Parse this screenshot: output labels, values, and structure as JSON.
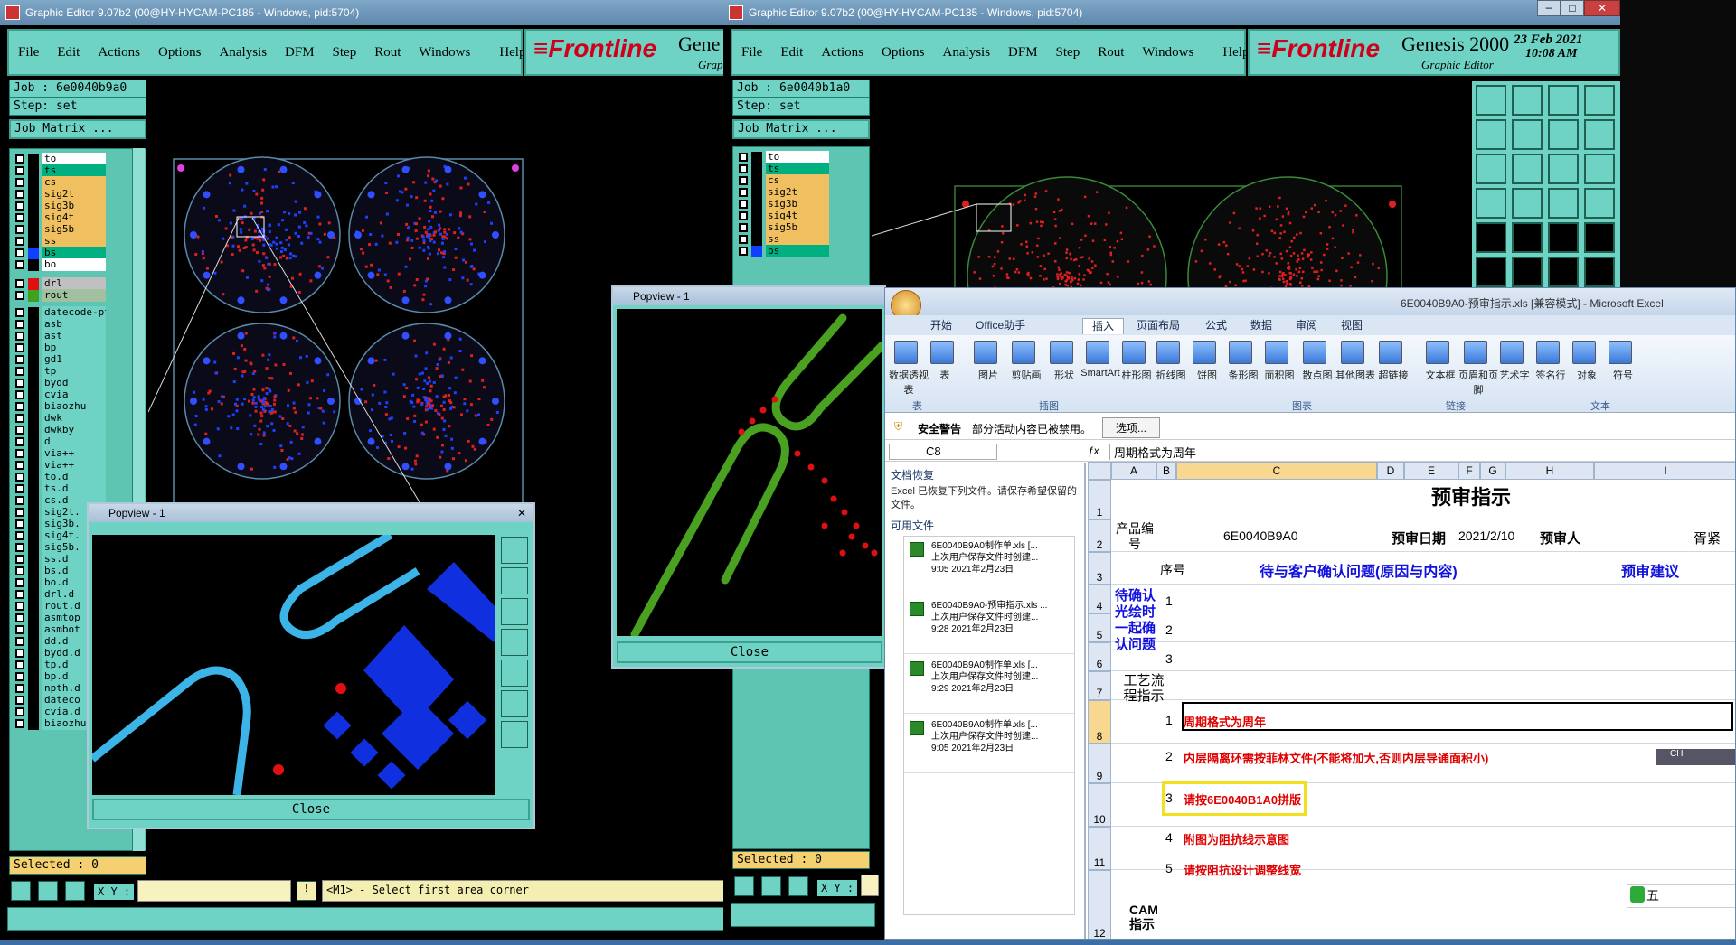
{
  "win1": {
    "title": "Graphic Editor 9.07b2 (00@HY-HYCAM-PC185 - Windows, pid:5704)",
    "menu": [
      "File",
      "Edit",
      "Actions",
      "Options",
      "Analysis",
      "DFM",
      "Step",
      "Rout",
      "Windows",
      "Help"
    ],
    "job": "Job : 6e0040b9a0",
    "step": "Step: set",
    "job_matrix": "Job Matrix ...",
    "selected": "Selected : 0",
    "xy_label": "X Y :",
    "prompt": "<M1> - Select first area corner",
    "brand_partial": "Gene",
    "brand_sub_partial": "Grap"
  },
  "win2": {
    "title": "Graphic Editor 9.07b2 (00@HY-HYCAM-PC185 - Windows, pid:5704)",
    "menu": [
      "File",
      "Edit",
      "Actions",
      "Options",
      "Analysis",
      "DFM",
      "Step",
      "Rout",
      "Windows",
      "Help"
    ],
    "job": "Job : 6e0040b1a0",
    "step": "Step: set",
    "job_matrix": "Job Matrix ...",
    "selected": "Selected : 0",
    "xy_label": "X Y :",
    "brand_title": "Genesis 2000",
    "brand_sub": "Graphic Editor",
    "date": "23 Feb 2021",
    "time": "10:08 AM"
  },
  "brand_logo": "Frontline",
  "layers_top": [
    {
      "name": "to",
      "color": "#ffffff"
    },
    {
      "name": "ts",
      "color": "#00b080"
    },
    {
      "name": "cs",
      "color": "#f0c060"
    },
    {
      "name": "sig2t",
      "color": "#f0c060"
    },
    {
      "name": "sig3b",
      "color": "#f0c060"
    },
    {
      "name": "sig4t",
      "color": "#f0c060"
    },
    {
      "name": "sig5b",
      "color": "#f0c060"
    },
    {
      "name": "ss",
      "color": "#f0c060"
    },
    {
      "name": "bs",
      "color": "#00b080"
    },
    {
      "name": "bo",
      "color": "#ffffff"
    }
  ],
  "layers_drill": [
    {
      "name": "drl",
      "color": "#c0c0c0"
    },
    {
      "name": "rout",
      "color": "#a0c0a0"
    }
  ],
  "layers_misc": [
    "datecode-pt",
    "asb",
    "ast",
    "bp",
    "gd1",
    "tp",
    "bydd",
    "cvia",
    "biaozhu",
    "dwk",
    "dwkby",
    "d",
    "via++",
    "via++",
    "to.d",
    "ts.d",
    "cs.d",
    "sig2t.",
    "sig3b.",
    "sig4t.",
    "sig5b.",
    "ss.d",
    "bs.d",
    "bo.d",
    "drl.d",
    "rout.d",
    "asmtop",
    "asmbot",
    "dd.d",
    "bydd.d",
    "tp.d",
    "bp.d",
    "npth.d",
    "dateco",
    "cvia.d",
    "biaozhu.d"
  ],
  "layers_short": [
    "to",
    "ts",
    "cs",
    "sig2t",
    "sig3b",
    "sig4t",
    "sig5b",
    "ss",
    "bs"
  ],
  "popup1": {
    "title": "Popview - 1",
    "close": "Close"
  },
  "popup2": {
    "title": "Popview - 1",
    "close": "Close"
  },
  "excel": {
    "title": "6E0040B9A0-预审指示.xls [兼容模式] - Microsoft Excel",
    "tabs": [
      "开始",
      "Office助手",
      "插入",
      "页面布局",
      "公式",
      "数据",
      "审阅",
      "视图"
    ],
    "ribbon_buttons": [
      "数据透视表",
      "表",
      "图片",
      "剪贴画",
      "形状",
      "SmartArt",
      "柱形图",
      "折线图",
      "饼图",
      "条形图",
      "面积图",
      "散点图",
      "其他图表",
      "超链接",
      "文本框",
      "页眉和页脚",
      "艺术字",
      "签名行",
      "对象",
      "符号"
    ],
    "groups": [
      "表",
      "插图",
      "图表",
      "链接",
      "文本"
    ],
    "security_label": "安全警告",
    "security_text": "部分活动内容已被禁用。",
    "options_btn": "选项...",
    "name_box": "C8",
    "formula": "周期格式为周年",
    "recovery_title": "文档恢复",
    "recovery_desc": "Excel 已恢复下列文件。请保存希望保留的文件。",
    "available": "可用文件",
    "recovered": [
      {
        "name": "6E0040B9A0制作单.xls [...",
        "desc": "上次用户保存文件时创建...",
        "time": "9:05 2021年2月23日"
      },
      {
        "name": "6E0040B9A0-预审指示.xls ...",
        "desc": "上次用户保存文件时创建...",
        "time": "9:28 2021年2月23日"
      },
      {
        "name": "6E0040B9A0制作单.xls [...",
        "desc": "上次用户保存文件时创建...",
        "time": "9:29 2021年2月23日"
      },
      {
        "name": "6E0040B9A0制作单.xls [...",
        "desc": "上次用户保存文件时创建...",
        "time": "9:05 2021年2月23日"
      }
    ],
    "columns": [
      "A",
      "B",
      "C",
      "D",
      "E",
      "F",
      "G",
      "H",
      "I"
    ],
    "rows": [
      "1",
      "2",
      "3",
      "4",
      "5",
      "6",
      "7",
      "8",
      "9",
      "10",
      "11",
      "12"
    ],
    "sheet_title": "预审指示",
    "product_label": "产品编号",
    "product_value": "6E0040B9A0",
    "review_date_label": "预审日期",
    "review_date": "2021/2/10",
    "reviewer_label": "预审人",
    "reviewer_partial": "胥紧",
    "seq_label": "序号",
    "issues_header": "待与客户确认问题(原因与内容)",
    "suggest_header": "预审建议",
    "confirm_label": "待确认光绘时一起确认问题",
    "process_label": "工艺流程指示",
    "cam_label": "CAM指示",
    "seq_vals": [
      "1",
      "2",
      "3"
    ],
    "cam_items": [
      {
        "n": "1",
        "t": "周期格式为周年"
      },
      {
        "n": "2",
        "t": "内层隔离环需按菲林文件(不能将加大,否则内层导通面积小)"
      },
      {
        "n": "3",
        "t": "请按6E0040B1A0拼版"
      },
      {
        "n": "4",
        "t": "附图为阻抗线示意图"
      },
      {
        "n": "5",
        "t": "请按阻抗设计调整线宽"
      }
    ],
    "ime_text": "五",
    "ime_lang": "CH"
  }
}
